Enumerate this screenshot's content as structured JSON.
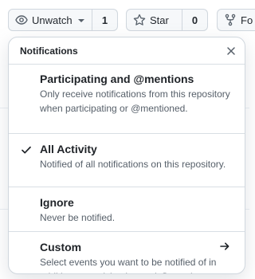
{
  "toolbar": {
    "watch": {
      "label": "Unwatch",
      "count": "1"
    },
    "star": {
      "label": "Star",
      "count": "0"
    },
    "fork": {
      "label": "Fo"
    }
  },
  "menu": {
    "title": "Notifications",
    "items": [
      {
        "title": "Participating and @mentions",
        "description": "Only receive notifications from this repository when participating or @mentioned.",
        "selected": false
      },
      {
        "title": "All Activity",
        "description": "Notified of all notifications on this repository.",
        "selected": true
      },
      {
        "title": "Ignore",
        "description": "Never be notified.",
        "selected": false
      },
      {
        "title": "Custom",
        "description": "Select events you want to be notified of in addition to participating and @mentions.",
        "selected": false,
        "has_submenu": true
      }
    ]
  }
}
